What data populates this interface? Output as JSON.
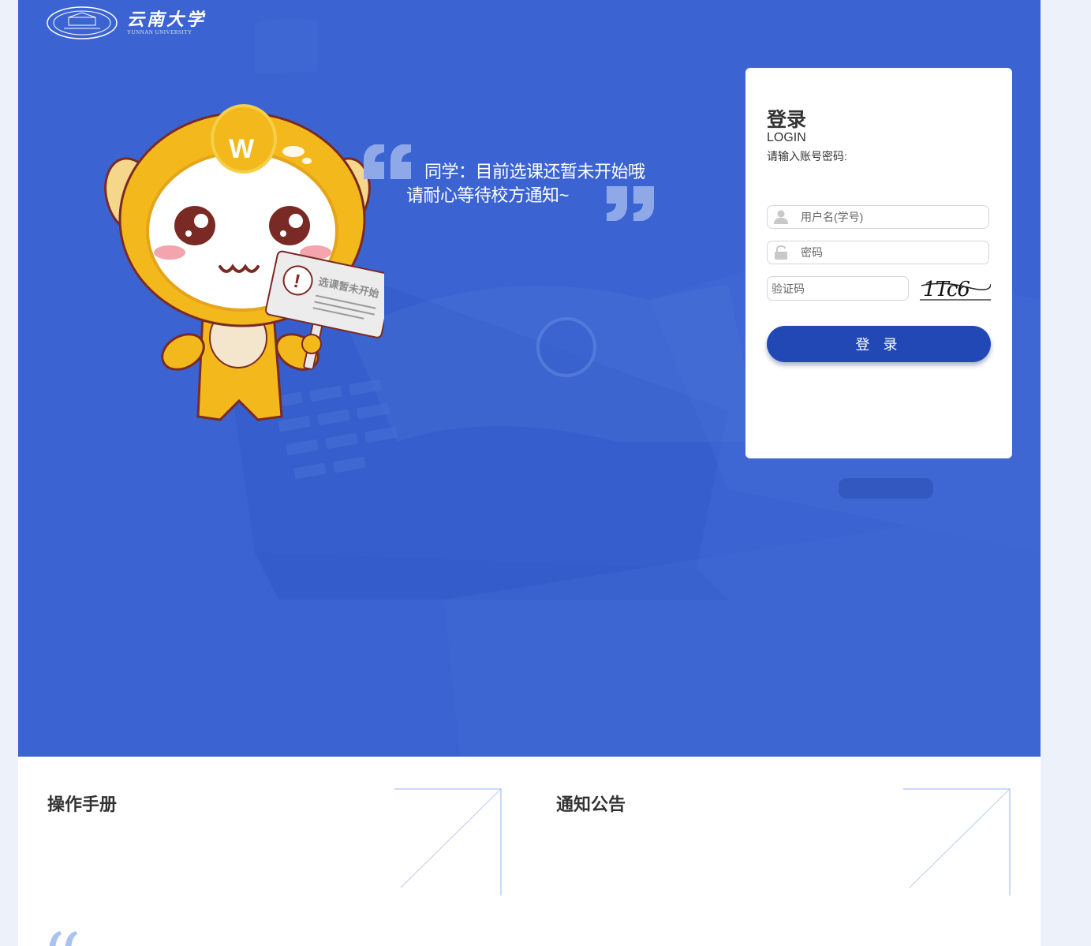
{
  "logo": {
    "name_cn": "云南大学",
    "name_en": "YUNNAN UNIVERSITY"
  },
  "banner": {
    "line1": "同学：目前选课还暂未开始哦",
    "line2": "请耐心等待校方通知~",
    "sign_text": "选课暂未开始"
  },
  "login": {
    "title": "登录",
    "subtitle": "LOGIN",
    "hint": "请输入账号密码:",
    "username_placeholder": "用户名(学号)",
    "password_placeholder": "密码",
    "captcha_placeholder": "验证码",
    "captcha_text": "1Tc6",
    "button_label": "登 录"
  },
  "panels": {
    "manual_title": "操作手册",
    "notice_title": "通知公告"
  },
  "colors": {
    "hero_blue": "#3b64d2",
    "button_blue": "#2148b4",
    "page_bg": "#edf2fa"
  }
}
